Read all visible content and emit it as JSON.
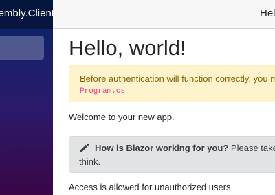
{
  "sidebar": {
    "brand": "embly.Client"
  },
  "topbar": {
    "link": "Hello"
  },
  "main": {
    "title": "Hello, world!",
    "alert_text": "Before authentication will function correctly, you must c",
    "alert_code": "Program.cs",
    "welcome": "Welcome to your new app.",
    "survey_strong": "How is Blazor working for you?",
    "survey_rest": " Please take our",
    "survey_line2": "think.",
    "access": "Access is allowed for unauthorized users"
  },
  "colors": {
    "alert_bg": "#fff3cd",
    "alert_text": "#856404",
    "code": "#e83e8c",
    "survey_bg": "#e2e3e5"
  },
  "icons": {
    "survey": "pencil-icon"
  }
}
